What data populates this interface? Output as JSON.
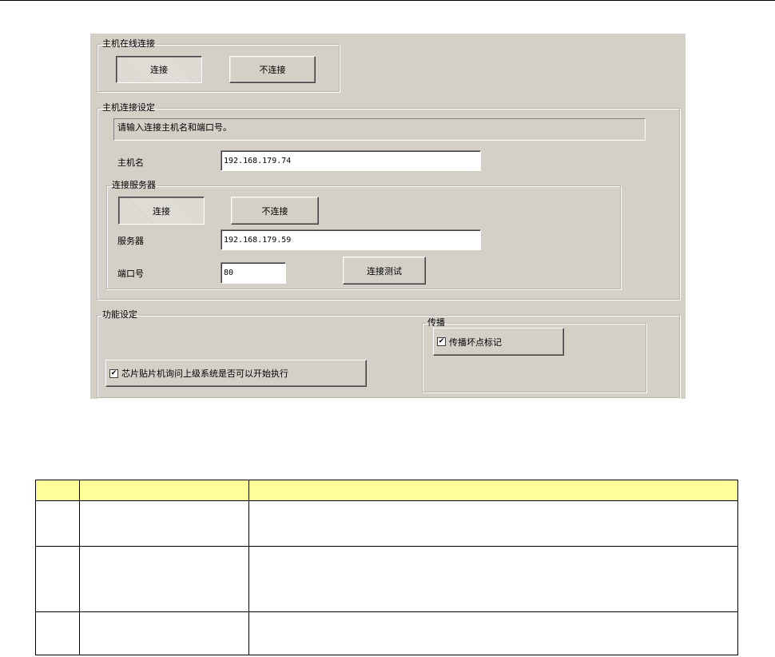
{
  "dialog": {
    "host_online": {
      "legend": "主机在线连接",
      "connect_label": "连接",
      "disconnect_label": "不连接"
    },
    "host_settings": {
      "legend": "主机连接设定",
      "instruction": "请输入连接主机名和端口号。",
      "hostname_label": "主机名",
      "hostname_value": "192.168.179.74",
      "server": {
        "legend": "连接服务器",
        "connect_label": "连接",
        "disconnect_label": "不连接",
        "server_label": "服务器",
        "server_value": "192.168.179.59",
        "port_label": "端口号",
        "port_value": "80",
        "test_label": "连接测试"
      }
    },
    "function_settings": {
      "legend": "功能设定",
      "inquiry_check_label": "芯片贴片机询问上级系统是否可以开始执行",
      "inquiry_checked": true,
      "broadcast": {
        "legend": "传播",
        "mark_check_label": "传播坏点标记",
        "mark_checked": true
      }
    }
  },
  "check_glyph": "✔"
}
